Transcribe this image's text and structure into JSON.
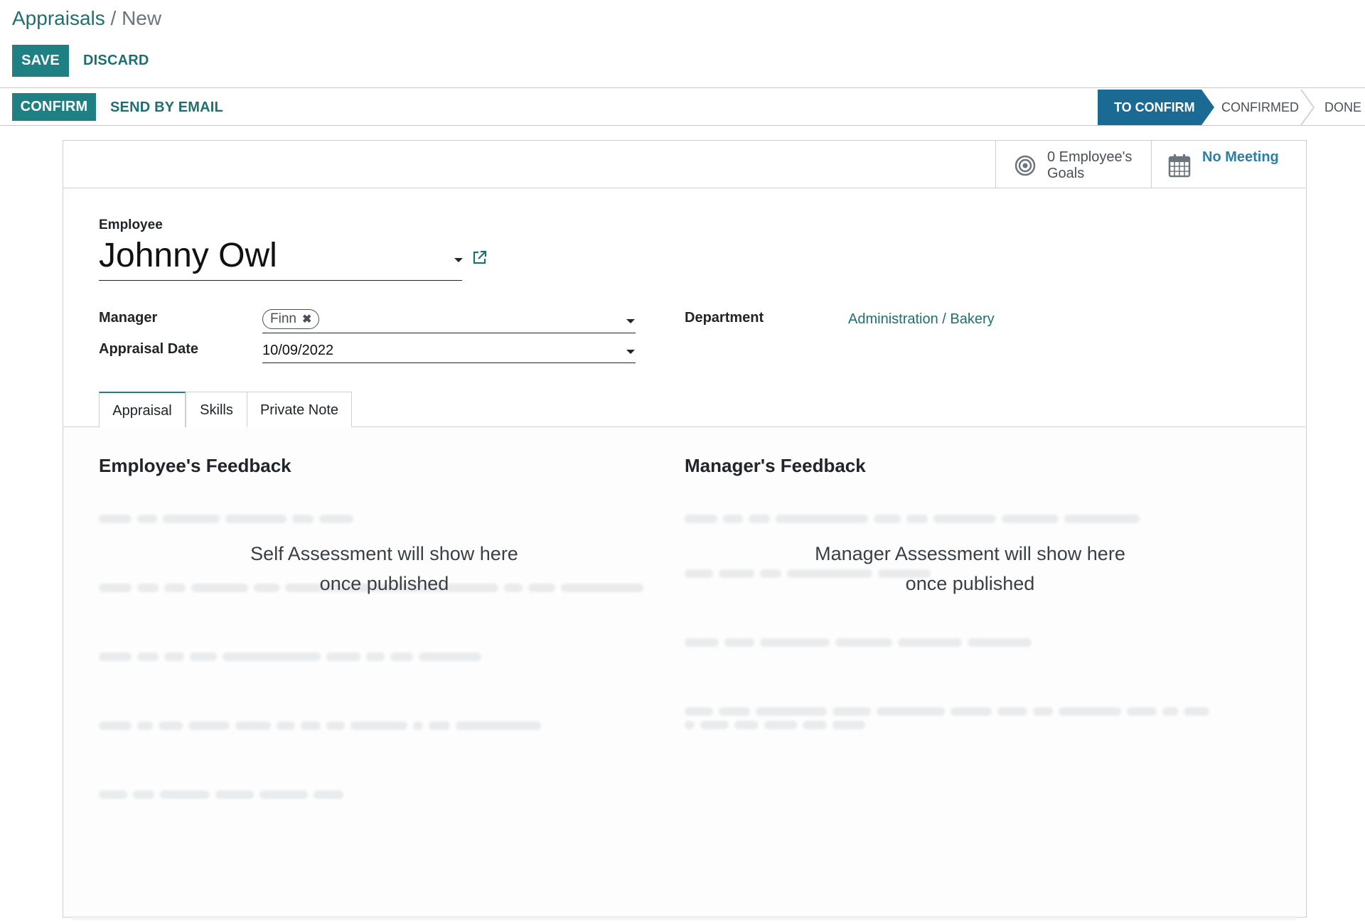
{
  "breadcrumb": {
    "root": "Appraisals",
    "separator": " / ",
    "current": "New"
  },
  "toolbar": {
    "save_label": "SAVE",
    "discard_label": "DISCARD"
  },
  "actions": {
    "confirm_label": "CONFIRM",
    "send_email_label": "SEND BY EMAIL"
  },
  "statusbar": {
    "stages": [
      "TO CONFIRM",
      "CONFIRMED",
      "DONE"
    ],
    "active": "TO CONFIRM"
  },
  "smart_buttons": {
    "goals": {
      "line1": "0 Employee's",
      "line2": "Goals",
      "icon": "target-icon"
    },
    "meeting": {
      "label": "No Meeting",
      "icon": "calendar-icon"
    }
  },
  "form": {
    "employee_label": "Employee",
    "employee_value": "Johnny Owl",
    "manager_label": "Manager",
    "manager_tag": "Finn",
    "appraisal_date_label": "Appraisal Date",
    "appraisal_date_value": "10/09/2022",
    "department_label": "Department",
    "department_value": "Administration / Bakery"
  },
  "tabs": [
    {
      "label": "Appraisal",
      "active": true
    },
    {
      "label": "Skills",
      "active": false
    },
    {
      "label": "Private Note",
      "active": false
    }
  ],
  "employee_feedback": {
    "title": "Employee's Feedback",
    "placeholder_line1": "Self Assessment will show here",
    "placeholder_line2": "once published"
  },
  "manager_feedback": {
    "title": "Manager's Feedback",
    "placeholder_line1": "Manager Assessment will show here",
    "placeholder_line2": "once published"
  },
  "colors": {
    "primary": "#1f8083",
    "active_stage": "#1b6a93",
    "link": "#1f6f71"
  }
}
